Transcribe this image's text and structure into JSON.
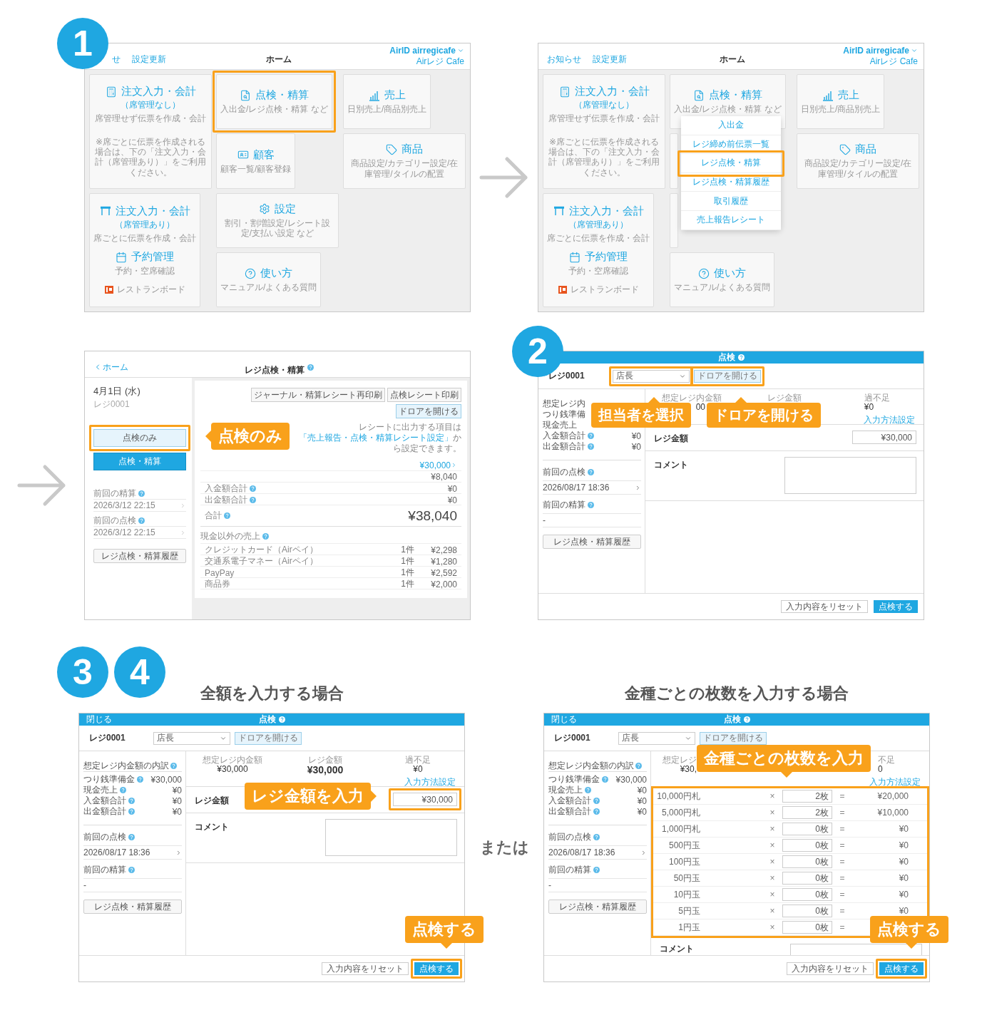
{
  "top_row": {
    "badge": "1",
    "screens": [
      {
        "header_links": [
          "せ",
          "設定更新"
        ],
        "title": "ホーム",
        "account": "AirID airregicafe",
        "store": "Airレジ Cafe",
        "cards": [
          {
            "kind": "tall",
            "highlighted": false,
            "sections": [
              {
                "kind": "calculator",
                "title": "注文入力・会計",
                "subtitle": "（席管理なし）",
                "desc": "席管理せず伝票を作成・会計"
              }
            ],
            "note": "※席ごとに伝票を作成される場合は、下の「注文入力・会計（席管理あり）」をご利用ください。"
          },
          {
            "kind": "tall",
            "highlighted": false,
            "sections": [
              {
                "kind": "table",
                "title": "注文入力・会計",
                "subtitle": "（席管理あり）",
                "desc": "席ごとに伝票を作成・会計"
              },
              {
                "kind": "calendar",
                "title": "予約管理",
                "desc": "予約・空席確認"
              }
            ],
            "footer_link": "レストランボード"
          },
          {
            "kind": "small",
            "highlighted": true,
            "sections": [
              {
                "kind": "search",
                "title": "点検・精算",
                "desc": "入出金/レジ点検・精算 など"
              }
            ]
          },
          {
            "kind": "small",
            "highlighted": false,
            "sections": [
              {
                "kind": "card",
                "title": "顧客",
                "desc": "顧客一覧/顧客登録"
              }
            ]
          },
          {
            "kind": "small",
            "highlighted": false,
            "sections": [
              {
                "kind": "gear",
                "title": "設定",
                "desc": "割引・割増設定/レシート設定/支払い設定 など"
              }
            ]
          },
          {
            "kind": "small",
            "highlighted": false,
            "sections": [
              {
                "kind": "question",
                "title": "使い方",
                "desc": "マニュアル/よくある質問"
              }
            ]
          },
          {
            "kind": "small",
            "highlighted": false,
            "sections": [
              {
                "kind": "chart",
                "title": "売上",
                "desc": "日別売上/商品別売上"
              }
            ]
          },
          {
            "kind": "small",
            "highlighted": false,
            "sections": [
              {
                "kind": "tag",
                "title": "商品",
                "desc": "商品設定/カテゴリー設定/在庫管理/タイルの配置"
              }
            ]
          }
        ]
      },
      {
        "header_links": [
          "お知らせ",
          "設定更新"
        ],
        "title": "ホーム",
        "account": "AirID airregicafe",
        "store": "Airレジ Cafe",
        "cards": [
          {
            "kind": "tall",
            "highlighted": false,
            "sections": [
              {
                "kind": "calculator",
                "title": "注文入力・会計",
                "subtitle": "（席管理なし）",
                "desc": "席管理せず伝票を作成・会計"
              }
            ],
            "note": "※席ごとに伝票を作成される場合は、下の「注文入力・会計（席管理あり）」をご利用ください。"
          },
          {
            "kind": "tall",
            "highlighted": false,
            "sections": [
              {
                "kind": "table",
                "title": "注文入力・会計",
                "subtitle": "（席管理あり）",
                "desc": "席ごとに伝票を作成・会計"
              },
              {
                "kind": "calendar",
                "title": "予約管理",
                "desc": "予約・空席確認"
              }
            ],
            "footer_link": "レストランボード"
          },
          {
            "kind": "small",
            "highlighted": false,
            "sections": [
              {
                "kind": "search",
                "title": "点検・精算",
                "desc": "入出金/レジ点検・精算 など"
              }
            ]
          },
          {
            "kind": "small",
            "highlighted": false
          },
          {
            "kind": "small",
            "highlighted": false
          },
          {
            "kind": "small",
            "highlighted": false,
            "sections": [
              {
                "kind": "question",
                "title": "使い方",
                "desc": "マニュアル/よくある質問"
              }
            ]
          },
          {
            "kind": "small",
            "highlighted": false,
            "sections": [
              {
                "kind": "chart",
                "title": "売上",
                "desc": "日別売上/商品別売上"
              }
            ]
          },
          {
            "kind": "small",
            "highlighted": false,
            "sections": [
              {
                "kind": "tag",
                "title": "商品",
                "desc": "商品設定/カテゴリー設定/在庫管理/タイルの配置"
              }
            ]
          }
        ],
        "menu": [
          {
            "label": "入出金",
            "highlighted": false
          },
          {
            "label": "レジ締め前伝票一覧",
            "highlighted": false
          },
          {
            "label": "レジ点検・精算",
            "highlighted": true
          },
          {
            "label": "レジ点検・精算履歴",
            "highlighted": false
          },
          {
            "label": "取引履歴",
            "highlighted": false
          },
          {
            "label": "売上報告レシート",
            "highlighted": false
          }
        ]
      }
    ]
  },
  "middle_row": {
    "badge": "2",
    "register_screen": {
      "back": "ホーム",
      "title": "レジ点検・精算",
      "date": "4月1日 (水)",
      "register": "レジ0001",
      "actions": [
        {
          "label": "点検のみ",
          "kind": "secondary",
          "highlighted": true
        },
        {
          "label": "点検・精算",
          "kind": "primary",
          "highlighted": false
        }
      ],
      "history": [
        {
          "heading": "前回の精算",
          "value": "2026/3/12 22:15"
        },
        {
          "heading": "前回の点検",
          "value": "2026/3/12 22:15"
        }
      ],
      "history_button": "レジ点検・精算履歴",
      "toolbar": [
        {
          "label": "ジャーナル・精算レシート再印刷",
          "kind": "plain"
        },
        {
          "label": "点検レシート印刷",
          "kind": "plain"
        },
        {
          "label": "ドロアを開ける",
          "kind": "accent"
        }
      ],
      "note": {
        "before": "レシートに出力する項目は",
        "link": "「売上報告・点検・精算レシート設定」",
        "after": "から設定できます。"
      },
      "cash_rows": [
        {
          "value": "¥30,000",
          "kind": "link"
        },
        {
          "value": "¥8,040",
          "kind": "plain"
        },
        {
          "label": "入金額合計",
          "value": "¥0",
          "kind": "plain"
        },
        {
          "label": "出金額合計",
          "value": "¥0",
          "kind": "plain"
        }
      ],
      "total": {
        "label": "合計",
        "value": "¥38,040"
      },
      "non_cash": {
        "heading": "現金以外の売上",
        "rows": [
          {
            "label": "クレジットカード（Airペイ）",
            "count": "1件",
            "value": "¥2,298"
          },
          {
            "label": "交通系電子マネー（Airペイ）",
            "count": "1件",
            "value": "¥1,280"
          },
          {
            "label": "PayPay",
            "count": "1件",
            "value": "¥2,592"
          },
          {
            "label": "商品券",
            "count": "1件",
            "value": "¥2,000"
          }
        ]
      },
      "callout": "点検のみ"
    },
    "check_modal": {
      "kind": "summary",
      "title": "点検",
      "register": "レジ0001",
      "staff": "店長",
      "staff_highlighted": true,
      "drawer_button": "ドロアを開ける",
      "drawer_highlighted": true,
      "breakdown": [
        {
          "label": "想定レジ内",
          "help": false
        },
        {
          "label": "つり銭準備",
          "help": false
        },
        {
          "label": "現金売上",
          "help": false
        },
        {
          "label": "入金額合計",
          "value": "¥0",
          "help": true
        },
        {
          "label": "出金額合計",
          "value": "¥0",
          "help": true
        }
      ],
      "last_check": {
        "heading": "前回の点検",
        "value": "2026/08/17 18:36"
      },
      "last_settlement": {
        "heading": "前回の精算",
        "value": "-"
      },
      "history_button": "レジ点検・精算履歴",
      "stats": [
        {
          "label": "想定レジ内金額",
          "value": "00"
        },
        {
          "label": "レジ金額"
        },
        {
          "label": "過不足",
          "value": "¥0"
        }
      ],
      "input_settings": "入力方法設定",
      "amount": {
        "label": "レジ金額",
        "value": "¥30,000",
        "highlighted": false
      },
      "comment": "コメント",
      "reset_button": "入力内容をリセット",
      "submit": {
        "label": "点検する",
        "highlighted": false
      },
      "callouts": [
        "担当者を選択",
        "ドロアを開ける"
      ]
    }
  },
  "bottom_row": {
    "badges": [
      "3",
      "4"
    ],
    "separator": "または",
    "options": [
      {
        "heading": "全額を入力する場合",
        "modal": {
          "kind": "amount",
          "close": "閉じる",
          "title": "点検",
          "register": "レジ0001",
          "staff": "店長",
          "staff_highlighted": false,
          "drawer_button": "ドロアを開ける",
          "drawer_highlighted": false,
          "breakdown_heading": "想定レジ内金額の内訳",
          "breakdown": [
            {
              "label": "つり銭準備金",
              "value": "¥30,000",
              "help": true
            },
            {
              "label": "現金売上",
              "value": "¥0",
              "help": true
            },
            {
              "label": "入金額合計",
              "value": "¥0",
              "help": true
            },
            {
              "label": "出金額合計",
              "value": "¥0",
              "help": true
            }
          ],
          "last_check": {
            "heading": "前回の点検",
            "value": "2026/08/17 18:36"
          },
          "last_settlement": {
            "heading": "前回の精算",
            "value": "-"
          },
          "history_button": "レジ点検・精算履歴",
          "stats": [
            {
              "label": "想定レジ内金額",
              "value": "¥30,000"
            },
            {
              "label": "レジ金額",
              "value": "¥30,000"
            },
            {
              "label": "過不足",
              "value": "¥0"
            }
          ],
          "input_settings": "入力方法設定",
          "amount": {
            "label": "レジ金額",
            "value": "¥30,000",
            "highlighted": true
          },
          "comment": "コメント",
          "reset_button": "入力内容をリセット",
          "submit": {
            "label": "点検する",
            "highlighted": true
          },
          "callouts": [
            "レジ金額を入力",
            "点検する"
          ]
        }
      },
      {
        "heading": "金種ごとの枚数を入力する場合",
        "modal": {
          "kind": "denominations",
          "close": "閉じる",
          "title": "点検",
          "register": "レジ0001",
          "staff": "店長",
          "staff_highlighted": false,
          "drawer_button": "ドロアを開ける",
          "drawer_highlighted": false,
          "breakdown_heading": "想定レジ内金額の内訳",
          "breakdown": [
            {
              "label": "つり銭準備金",
              "value": "¥30,000",
              "help": true
            },
            {
              "label": "現金売上",
              "value": "¥0",
              "help": true
            },
            {
              "label": "入金額合計",
              "value": "¥0",
              "help": true
            },
            {
              "label": "出金額合計",
              "value": "¥0",
              "help": true
            }
          ],
          "last_check": {
            "heading": "前回の点検",
            "value": "2026/08/17 18:36"
          },
          "last_settlement": {
            "heading": "前回の精算",
            "value": "-"
          },
          "history_button": "レジ点検・精算履歴",
          "stats": [
            {
              "label": "想定レジ",
              "value": "¥30,"
            },
            {
              "label": "不足",
              "value": "0"
            }
          ],
          "input_settings": "入力方法設定",
          "denominations": {
            "highlighted": true,
            "rows": [
              {
                "label": "10,000円札",
                "times": "×",
                "count": "2枚",
                "equals": "=",
                "amount": "¥20,000"
              },
              {
                "label": "5,000円札",
                "times": "×",
                "count": "2枚",
                "equals": "=",
                "amount": "¥10,000"
              },
              {
                "label": "1,000円札",
                "times": "×",
                "count": "0枚",
                "equals": "=",
                "amount": "¥0"
              },
              {
                "label": "500円玉",
                "times": "×",
                "count": "0枚",
                "equals": "=",
                "amount": "¥0"
              },
              {
                "label": "100円玉",
                "times": "×",
                "count": "0枚",
                "equals": "=",
                "amount": "¥0"
              },
              {
                "label": "50円玉",
                "times": "×",
                "count": "0枚",
                "equals": "=",
                "amount": "¥0"
              },
              {
                "label": "10円玉",
                "times": "×",
                "count": "0枚",
                "equals": "=",
                "amount": "¥0"
              },
              {
                "label": "5円玉",
                "times": "×",
                "count": "0枚",
                "equals": "=",
                "amount": "¥0"
              },
              {
                "label": "1円玉",
                "times": "×",
                "count": "0枚",
                "equals": "="
              }
            ]
          },
          "comment": "コメント",
          "reset_button": "入力内容をリセット",
          "submit": {
            "label": "点検する",
            "highlighted": true
          },
          "callouts": [
            "金種ごとの枚数を入力",
            "点検する"
          ]
        }
      }
    ]
  }
}
